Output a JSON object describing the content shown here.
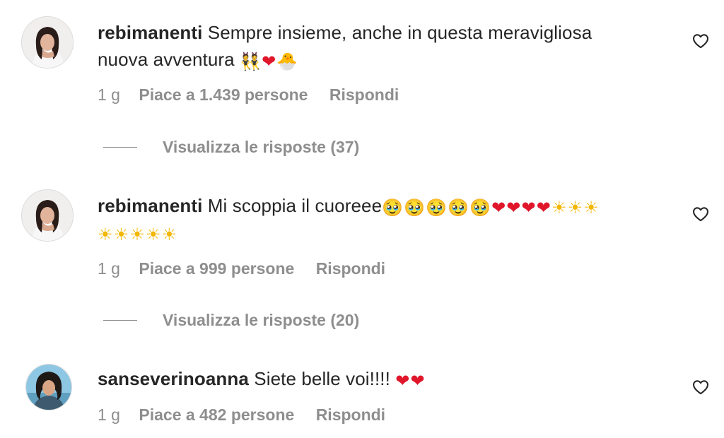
{
  "comments": [
    {
      "username": "rebimanenti",
      "text_line1": "Sempre insieme, anche in questa meravigliosa",
      "text_line2": "nuova avventura",
      "emojis": [
        "👯",
        "❤",
        "🐣"
      ],
      "time": "1 g",
      "likes": "Piace a 1.439 persone",
      "reply": "Rispondi",
      "view_replies": "Visualizza le risposte (37)"
    },
    {
      "username": "rebimanenti",
      "text_line1": "Mi scoppia il cuoreee",
      "emojis_line1": [
        "🥹",
        "🥹",
        "🥹",
        "🥹",
        "🥹",
        "❤",
        "❤",
        "❤",
        "❤",
        "☀",
        "☀",
        "☀"
      ],
      "emojis_line2": [
        "☀",
        "☀",
        "☀",
        "☀",
        "☀"
      ],
      "time": "1 g",
      "likes": "Piace a 999 persone",
      "reply": "Rispondi",
      "view_replies": "Visualizza le risposte (20)"
    },
    {
      "username": "sanseverinoanna",
      "text_line1": "Siete belle voi!!!!",
      "emojis": [
        "❤",
        "❤"
      ],
      "time": "1 g",
      "likes": "Piace a 482 persone",
      "reply": "Rispondi"
    }
  ],
  "icons": {
    "like": "heart-outline-icon"
  },
  "colors": {
    "text": "#262626",
    "secondary": "#8e8e8e",
    "heart": "#e0162b"
  }
}
